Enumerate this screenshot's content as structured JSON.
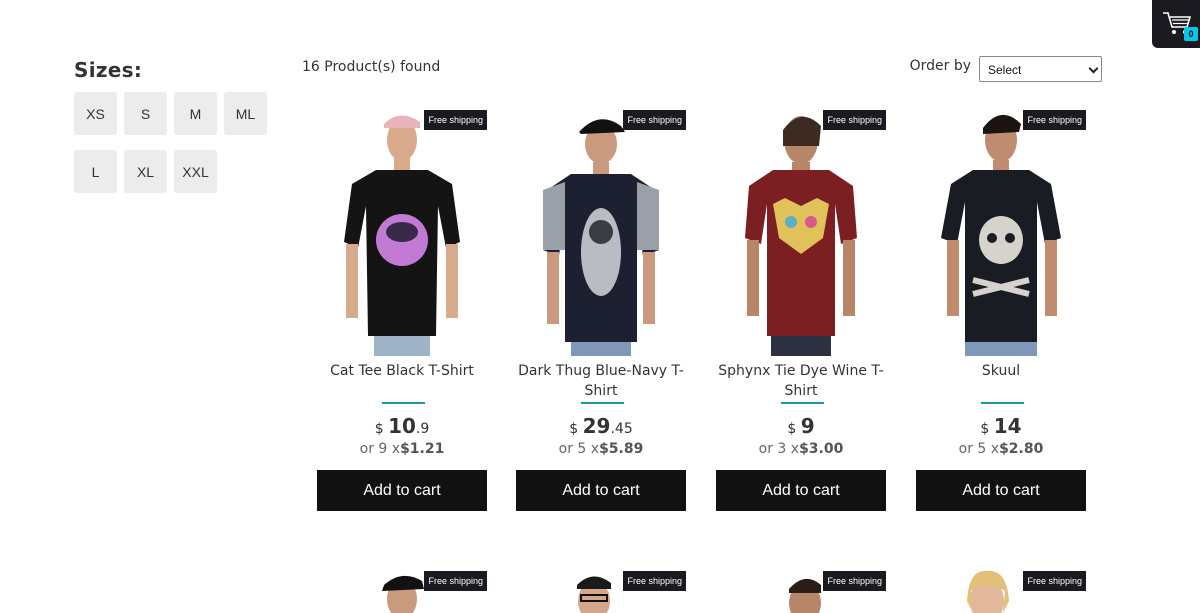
{
  "cart": {
    "count": "0",
    "icon": "cart-icon"
  },
  "filters": {
    "title": "Sizes:",
    "sizes": [
      "XS",
      "S",
      "M",
      "ML",
      "L",
      "XL",
      "XXL"
    ]
  },
  "shelf": {
    "found": "16 Product(s) found",
    "order_label": "Order by",
    "order_value": "Select"
  },
  "products": [
    {
      "title": "Cat Tee Black T-Shirt",
      "currency": "$",
      "price_int": "10",
      "price_dec": ".9",
      "installments_prefix": "or 9 x",
      "installments_value": "$1.21",
      "tag": "Free shipping",
      "cta": "Add to cart"
    },
    {
      "title": "Dark Thug Blue-Navy T-Shirt",
      "currency": "$",
      "price_int": "29",
      "price_dec": ".45",
      "installments_prefix": "or 5 x",
      "installments_value": "$5.89",
      "tag": "Free shipping",
      "cta": "Add to cart"
    },
    {
      "title": "Sphynx Tie Dye Wine T-Shirt",
      "currency": "$",
      "price_int": "9",
      "price_dec": "",
      "installments_prefix": "or 3 x",
      "installments_value": "$3.00",
      "tag": "Free shipping",
      "cta": "Add to cart"
    },
    {
      "title": "Skuul",
      "currency": "$",
      "price_int": "14",
      "price_dec": "",
      "installments_prefix": "or 5 x",
      "installments_value": "$2.80",
      "tag": "Free shipping",
      "cta": "Add to cart"
    }
  ],
  "next_row": [
    {
      "tag": "Free shipping"
    },
    {
      "tag": "Free shipping"
    },
    {
      "tag": "Free shipping"
    },
    {
      "tag": "Free shipping"
    }
  ],
  "colors": {
    "accent": "#1e9aa4",
    "button": "#111111",
    "cart_badge": "#00c9e8",
    "shirts": [
      "#141414",
      "#1c2030",
      "#7b1f22",
      "#1a1c24"
    ]
  }
}
